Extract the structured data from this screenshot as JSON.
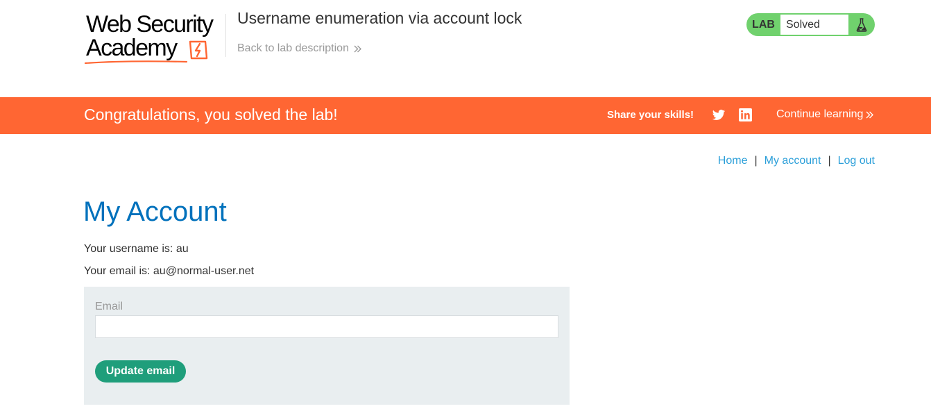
{
  "header": {
    "logo_line1": "Web Security",
    "logo_line2": "Academy",
    "lab_title": "Username enumeration via account lock",
    "back_link": "Back to lab description",
    "lab_status": {
      "tag": "LAB",
      "value": "Solved",
      "icon": "flask-icon"
    }
  },
  "banner": {
    "message": "Congratulations, you solved the lab!",
    "share_label": "Share your skills!",
    "share_icons": [
      "twitter-icon",
      "linkedin-icon"
    ],
    "continue_label": "Continue learning"
  },
  "nav": {
    "items": [
      "Home",
      "My account",
      "Log out"
    ],
    "separator": "|"
  },
  "main": {
    "title": "My Account",
    "username_line": "Your username is: au",
    "email_line": "Your email is: au@normal-user.net",
    "form": {
      "email_label": "Email",
      "email_value": "",
      "submit_label": "Update email"
    }
  },
  "colors": {
    "banner": "#ff6633",
    "lab_status": "#70d16d",
    "title": "#0071bc",
    "link": "#2b9fd9",
    "button": "#1f9e7b",
    "form_panel": "#e9eef0"
  }
}
